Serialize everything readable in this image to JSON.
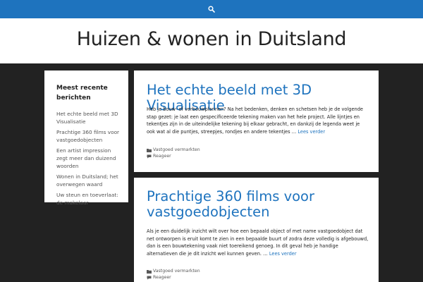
{
  "topbar": {
    "search_icon": "search-icon",
    "color": "#1e73be"
  },
  "header": {
    "site_title": "Huizen & wonen in Duitsland"
  },
  "sidebar": {
    "widget_title": "Meest recente berichten",
    "items": [
      "Het echte beeld met 3D Visualisatie",
      "Prachtige 360 films voor vastgoedobjecten",
      "Een artist impression zegt meer dan duizend woorden",
      "Wonen in Duitsland; het overwegen waard",
      "Uw steun en toeverlaat: de makelaar"
    ]
  },
  "posts": [
    {
      "title": "Het echte beeld met 3D Visualisatie",
      "excerpt": "Heb je bouw- of verbouwplannen? Na het bedenken, denken en schetsen heb je de volgende stap gezet: je laat een gespecificeerde tekening maken van het hele project. Alle lijntjes en tekentjes zijn in de uiteindelijke tekening bij elkaar gebracht, en dankzij de legenda weet je ook wat al die puntjes, streepjes, rondjes en andere tekentjes …",
      "readmore": "Lees verder",
      "category": "Vastgoed vermarkten",
      "comment": "Reageer"
    },
    {
      "title": "Prachtige 360 films voor vastgoedobjecten",
      "excerpt": "Als je een duidelijk inzicht wilt over hoe een bepaald object of met name vastgoedobject dat net ontworpen is eruit komt te zien in een bepaalde buurt of zodra deze volledig is afgebouwd, dan is een bouwtekening vaak niet toereikend genoeg. In dit geval heb je handige alternatieven die je dit inzicht wel kunnen geven. …",
      "readmore": "Lees verder",
      "category": "Vastgoed vermarkten",
      "comment": "Reageer"
    }
  ]
}
